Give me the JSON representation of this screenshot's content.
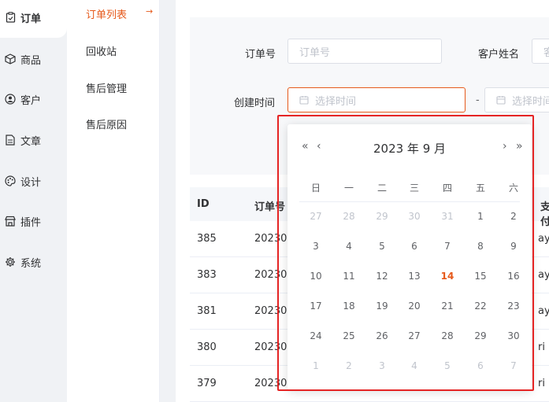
{
  "nav": {
    "items": [
      {
        "label": "订单",
        "icon": "clipboard-icon"
      },
      {
        "label": "商品",
        "icon": "box-icon"
      },
      {
        "label": "客户",
        "icon": "user-circle-icon"
      },
      {
        "label": "文章",
        "icon": "document-icon"
      },
      {
        "label": "设计",
        "icon": "palette-icon"
      },
      {
        "label": "插件",
        "icon": "store-icon"
      },
      {
        "label": "系统",
        "icon": "gear-icon"
      }
    ]
  },
  "subnav": {
    "items": [
      {
        "label": "订单列表"
      },
      {
        "label": "回收站"
      },
      {
        "label": "售后管理"
      },
      {
        "label": "售后原因"
      }
    ],
    "active_arrow": "→"
  },
  "filter": {
    "order_no_label": "订单号",
    "order_no_placeholder": "订单号",
    "customer_label": "客户姓名",
    "customer_placeholder": "客",
    "created_label": "创建时间",
    "start_placeholder": "选择时间",
    "separator": "-",
    "end_placeholder": "选择时间"
  },
  "table": {
    "headers": [
      "ID",
      "订单号",
      "支付"
    ],
    "rows": [
      {
        "id": "385",
        "order_no": "20230",
        "pay": "ay"
      },
      {
        "id": "383",
        "order_no": "20230",
        "pay": "ay"
      },
      {
        "id": "381",
        "order_no": "20230",
        "pay": "ay"
      },
      {
        "id": "380",
        "order_no": "20230",
        "pay": "ri"
      },
      {
        "id": "379",
        "order_no": "20230",
        "pay": "ri"
      }
    ]
  },
  "picker": {
    "title": "2023 年  9 月",
    "prev_year": "«",
    "prev_month": "‹",
    "next_month": "›",
    "next_year": "»",
    "weekdays": [
      "日",
      "一",
      "二",
      "三",
      "四",
      "五",
      "六"
    ],
    "weeks": [
      [
        {
          "d": "27",
          "o": true
        },
        {
          "d": "28",
          "o": true
        },
        {
          "d": "29",
          "o": true
        },
        {
          "d": "30",
          "o": true
        },
        {
          "d": "31",
          "o": true
        },
        {
          "d": "1"
        },
        {
          "d": "2"
        }
      ],
      [
        {
          "d": "3"
        },
        {
          "d": "4"
        },
        {
          "d": "5"
        },
        {
          "d": "6"
        },
        {
          "d": "7"
        },
        {
          "d": "8"
        },
        {
          "d": "9"
        }
      ],
      [
        {
          "d": "10"
        },
        {
          "d": "11"
        },
        {
          "d": "12"
        },
        {
          "d": "13"
        },
        {
          "d": "14",
          "t": true
        },
        {
          "d": "15"
        },
        {
          "d": "16"
        }
      ],
      [
        {
          "d": "17"
        },
        {
          "d": "18"
        },
        {
          "d": "19"
        },
        {
          "d": "20"
        },
        {
          "d": "21"
        },
        {
          "d": "22"
        },
        {
          "d": "23"
        }
      ],
      [
        {
          "d": "24"
        },
        {
          "d": "25"
        },
        {
          "d": "26"
        },
        {
          "d": "27"
        },
        {
          "d": "28"
        },
        {
          "d": "29"
        },
        {
          "d": "30"
        }
      ],
      [
        {
          "d": "1",
          "o": true
        },
        {
          "d": "2",
          "o": true
        },
        {
          "d": "3",
          "o": true
        },
        {
          "d": "4",
          "o": true
        },
        {
          "d": "5",
          "o": true
        },
        {
          "d": "6",
          "o": true
        },
        {
          "d": "7",
          "o": true
        }
      ]
    ]
  },
  "colors": {
    "accent": "#e6591b",
    "highlight_box": "#e52424"
  }
}
